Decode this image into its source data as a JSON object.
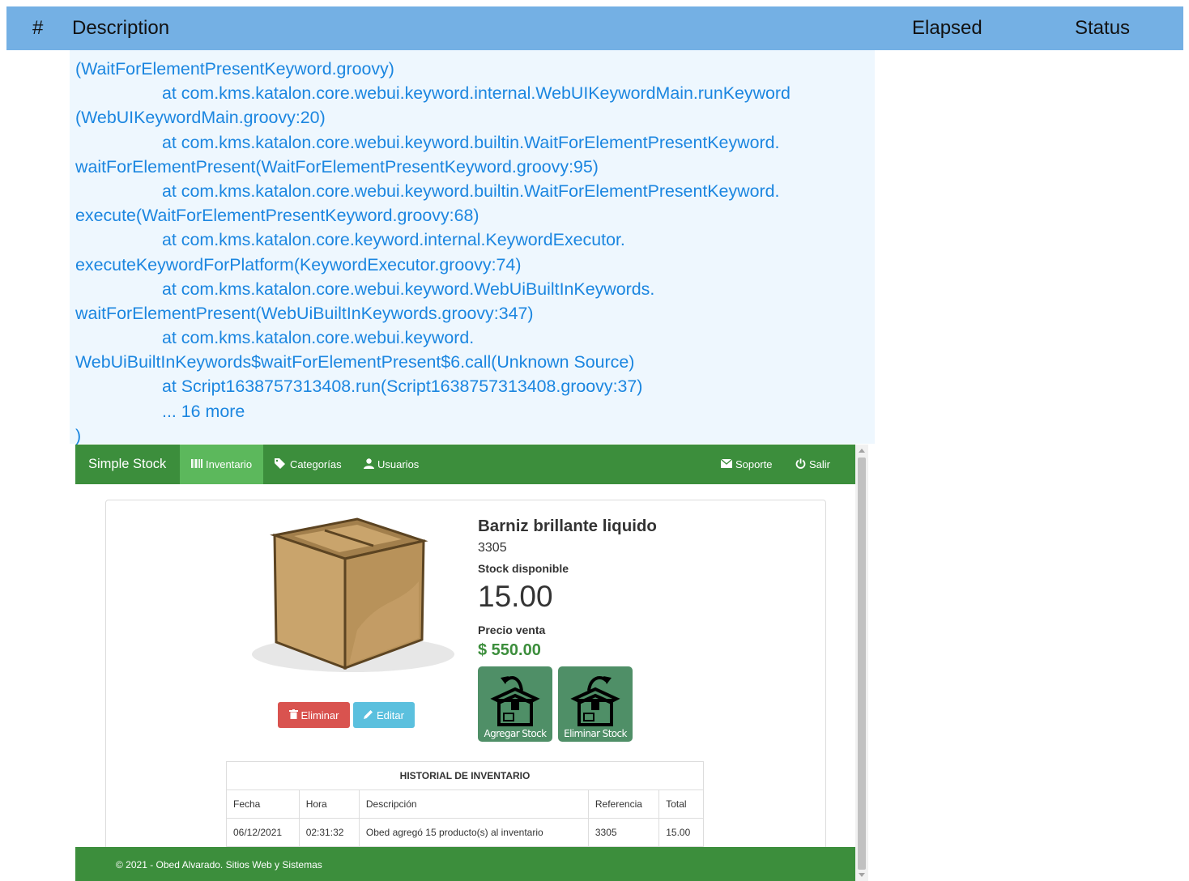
{
  "report_header": {
    "num": "#",
    "description": "Description",
    "elapsed": "Elapsed",
    "status": "Status"
  },
  "log": {
    "lines": [
      {
        "text": "(WaitForElementPresentKeyword.groovy)",
        "indent": false
      },
      {
        "text": "at com.kms.katalon.core.webui.keyword.internal.WebUIKeywordMain.runKeyword",
        "indent": true
      },
      {
        "text": "(WebUIKeywordMain.groovy:20)",
        "indent": false
      },
      {
        "text": "at com.kms.katalon.core.webui.keyword.builtin.WaitForElementPresentKeyword.",
        "indent": true
      },
      {
        "text": "waitForElementPresent(WaitForElementPresentKeyword.groovy:95)",
        "indent": false
      },
      {
        "text": "at com.kms.katalon.core.webui.keyword.builtin.WaitForElementPresentKeyword.",
        "indent": true
      },
      {
        "text": "execute(WaitForElementPresentKeyword.groovy:68)",
        "indent": false
      },
      {
        "text": "at com.kms.katalon.core.keyword.internal.KeywordExecutor.",
        "indent": true
      },
      {
        "text": "executeKeywordForPlatform(KeywordExecutor.groovy:74)",
        "indent": false
      },
      {
        "text": "at com.kms.katalon.core.webui.keyword.WebUiBuiltInKeywords.",
        "indent": true
      },
      {
        "text": "waitForElementPresent(WebUiBuiltInKeywords.groovy:347)",
        "indent": false
      },
      {
        "text": "at com.kms.katalon.core.webui.keyword.",
        "indent": true
      },
      {
        "text": "WebUiBuiltInKeywords$waitForElementPresent$6.call(Unknown Source)",
        "indent": false
      },
      {
        "text": "at Script1638757313408.run(Script1638757313408.groovy:37)",
        "indent": true
      },
      {
        "text": "... 16 more",
        "indent": true
      },
      {
        "text": ")",
        "indent": false
      }
    ]
  },
  "app": {
    "brand": "Simple Stock",
    "nav": {
      "inventario": "Inventario",
      "categorias": "Categorías",
      "usuarios": "Usuarios",
      "soporte": "Soporte",
      "salir": "Salir"
    },
    "product": {
      "title": "Barniz brillante liquido",
      "code": "3305",
      "stock_label": "Stock disponible",
      "stock_value": "15.00",
      "price_label": "Precio venta",
      "price_value": "$ 550.00"
    },
    "buttons": {
      "eliminar": "Eliminar",
      "editar": "Editar",
      "agregar_stock": "Agregar Stock",
      "eliminar_stock": "Eliminar Stock"
    },
    "history": {
      "caption": "HISTORIAL DE INVENTARIO",
      "headers": [
        "Fecha",
        "Hora",
        "Descripción",
        "Referencia",
        "Total"
      ],
      "rows": [
        [
          "06/12/2021",
          "02:31:32",
          "Obed agregó 15 producto(s) al inventario",
          "3305",
          "15.00"
        ]
      ]
    },
    "footer": "© 2021 - Obed Alvarado. Sitios Web y Sistemas"
  },
  "colors": {
    "report_header_bg": "#74b0e4",
    "log_text": "#1b86e0",
    "log_bg": "#eef7fe",
    "navbar_green": "#3c8e3c",
    "nav_active": "#5cb85c",
    "danger": "#d9534f",
    "info": "#5bc0de",
    "stock_button": "#4f8f67"
  }
}
